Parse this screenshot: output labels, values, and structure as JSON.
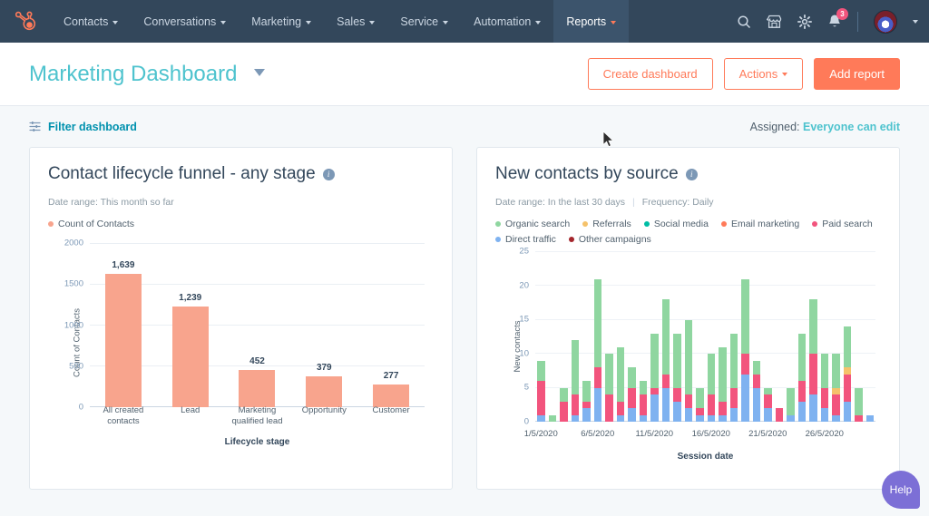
{
  "topnav": {
    "logo": "hubspot-sprocket-logo",
    "items": [
      {
        "label": "Contacts",
        "active": false
      },
      {
        "label": "Conversations",
        "active": false
      },
      {
        "label": "Marketing",
        "active": false
      },
      {
        "label": "Sales",
        "active": false
      },
      {
        "label": "Service",
        "active": false
      },
      {
        "label": "Automation",
        "active": false
      },
      {
        "label": "Reports",
        "active": true
      }
    ],
    "icons": [
      {
        "name": "search-icon"
      },
      {
        "name": "marketplace-icon"
      },
      {
        "name": "settings-gear-icon"
      },
      {
        "name": "notifications-bell-icon"
      }
    ],
    "notification_count": "3"
  },
  "header": {
    "title": "Marketing Dashboard",
    "title_color": "#4ec3ce",
    "create_dashboard_label": "Create dashboard",
    "actions_label": "Actions",
    "add_report_label": "Add report",
    "accent_color": "#ff7a59"
  },
  "filterbar": {
    "filter_label": "Filter dashboard",
    "assigned_prefix": "Assigned:",
    "assigned_value": "Everyone can edit"
  },
  "cards": [
    {
      "title": "Contact lifecycle funnel - any stage",
      "date_range": "Date range: This month so far",
      "frequency": ""
    },
    {
      "title": "New contacts by source",
      "date_range": "Date range: In the last 30 days",
      "frequency": "Frequency: Daily"
    }
  ],
  "help": {
    "label": "Help",
    "color": "#7c6fd6"
  },
  "chart_data": [
    {
      "type": "bar",
      "title": "Contact lifecycle funnel - any stage",
      "xlabel": "Lifecycle stage",
      "ylabel": "Count of Contacts",
      "ylim": [
        0,
        2000
      ],
      "yticks": [
        0,
        500,
        1000,
        1500,
        2000
      ],
      "ytick_labels": [
        "0",
        "500",
        "1000",
        "1500",
        "2000"
      ],
      "grid": true,
      "legend": [
        {
          "name": "Count of Contacts",
          "color": "#f8a48d"
        }
      ],
      "legend_position": "top-left",
      "categories": [
        "All created contacts",
        "Lead",
        "Marketing qualified lead",
        "Opportunity",
        "Customer"
      ],
      "values": [
        1639,
        1239,
        452,
        379,
        277
      ],
      "value_labels": [
        "1,639",
        "1,239",
        "452",
        "379",
        "277"
      ],
      "bar_color": "#f8a48d"
    },
    {
      "type": "bar",
      "subtype": "stacked",
      "title": "New contacts by source",
      "xlabel": "Session date",
      "ylabel": "New contacts",
      "ylim": [
        0,
        25
      ],
      "yticks": [
        0,
        5,
        10,
        15,
        20,
        25
      ],
      "ytick_labels": [
        "0",
        "5",
        "10",
        "15",
        "20",
        "25"
      ],
      "grid": true,
      "legend_position": "top-left",
      "x": [
        "1/5/2020",
        "2/5/2020",
        "3/5/2020",
        "4/5/2020",
        "5/5/2020",
        "6/5/2020",
        "7/5/2020",
        "8/5/2020",
        "9/5/2020",
        "10/5/2020",
        "11/5/2020",
        "12/5/2020",
        "13/5/2020",
        "14/5/2020",
        "15/5/2020",
        "16/5/2020",
        "17/5/2020",
        "18/5/2020",
        "19/5/2020",
        "20/5/2020",
        "21/5/2020",
        "22/5/2020",
        "23/5/2020",
        "24/5/2020",
        "25/5/2020",
        "26/5/2020",
        "27/5/2020",
        "28/5/2020",
        "29/5/2020",
        "30/5/2020"
      ],
      "xtick_labels": [
        "1/5/2020",
        "6/5/2020",
        "11/5/2020",
        "16/5/2020",
        "21/5/2020",
        "26/5/2020"
      ],
      "xtick_indices": [
        0,
        5,
        10,
        15,
        20,
        25
      ],
      "series": [
        {
          "name": "Direct traffic",
          "color": "#7fb2f0",
          "values": [
            1,
            0,
            0,
            1,
            2,
            5,
            0,
            1,
            2,
            1,
            4,
            5,
            3,
            2,
            1,
            1,
            1,
            2,
            7,
            5,
            2,
            0,
            1,
            3,
            4,
            2,
            1,
            3,
            0,
            1
          ]
        },
        {
          "name": "Paid search",
          "color": "#f2547d",
          "values": [
            5,
            0,
            3,
            3,
            1,
            3,
            4,
            2,
            3,
            3,
            1,
            2,
            2,
            2,
            1,
            3,
            2,
            3,
            3,
            2,
            2,
            2,
            0,
            3,
            6,
            3,
            3,
            4,
            1,
            0
          ]
        },
        {
          "name": "Referrals",
          "color": "#f5c26b",
          "values": [
            0,
            0,
            0,
            0,
            0,
            0,
            0,
            0,
            0,
            0,
            0,
            0,
            0,
            0,
            0,
            0,
            0,
            0,
            0,
            0,
            0,
            0,
            0,
            0,
            0,
            0,
            1,
            1,
            0,
            0
          ]
        },
        {
          "name": "Organic search",
          "color": "#8fd6a0",
          "values": [
            3,
            1,
            2,
            8,
            3,
            13,
            6,
            8,
            3,
            2,
            8,
            11,
            8,
            11,
            3,
            6,
            8,
            8,
            11,
            2,
            1,
            0,
            4,
            7,
            8,
            5,
            5,
            6,
            4,
            0
          ]
        },
        {
          "name": "Social media",
          "color": "#00bda5",
          "values": [
            0,
            0,
            0,
            0,
            0,
            0,
            0,
            0,
            0,
            0,
            0,
            0,
            0,
            0,
            0,
            0,
            0,
            0,
            0,
            0,
            0,
            0,
            0,
            0,
            0,
            0,
            0,
            0,
            0,
            0
          ]
        },
        {
          "name": "Email marketing",
          "color": "#ff7a59",
          "values": [
            0,
            0,
            0,
            0,
            0,
            0,
            0,
            0,
            0,
            0,
            0,
            0,
            0,
            0,
            0,
            0,
            0,
            0,
            0,
            0,
            0,
            0,
            0,
            0,
            0,
            0,
            0,
            0,
            0,
            0
          ]
        },
        {
          "name": "Other campaigns",
          "color": "#a4262c",
          "values": [
            0,
            0,
            0,
            0,
            0,
            0,
            0,
            0,
            0,
            0,
            0,
            0,
            0,
            0,
            0,
            0,
            0,
            0,
            0,
            0,
            0,
            0,
            0,
            0,
            0,
            0,
            0,
            0,
            0,
            0
          ]
        }
      ],
      "legend_order": [
        "Organic search",
        "Referrals",
        "Social media",
        "Email marketing",
        "Paid search",
        "Direct traffic",
        "Other campaigns"
      ]
    }
  ]
}
